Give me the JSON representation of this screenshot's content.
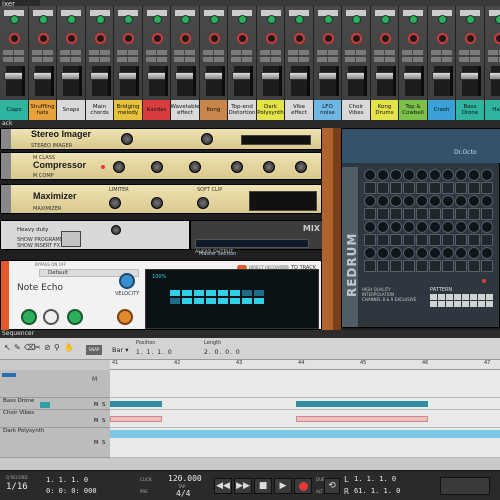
{
  "colors": {
    "accent": "#e35a2a",
    "knob_green": "#2eae5a",
    "record_red": "#d23a3a",
    "display_cyan": "#2fd0e8"
  },
  "mixer": {
    "title": "ixer",
    "channels": [
      {
        "name": "Claps",
        "color": "#2fb4a0"
      },
      {
        "name": "Shuffling hats",
        "color": "#e8a23a"
      },
      {
        "name": "Snaps",
        "color": "#d9d9d9"
      },
      {
        "name": "Main chords",
        "color": "#d9d9d9"
      },
      {
        "name": "Bridging melody",
        "color": "#e8c23a"
      },
      {
        "name": "Kasdas",
        "color": "#d83c3c"
      },
      {
        "name": "Wavetable effect",
        "color": "#d9d9d9"
      },
      {
        "name": "Kong",
        "color": "#c8864a"
      },
      {
        "name": "Top-end Distortion",
        "color": "#d9d9d9"
      },
      {
        "name": "Dark Polysynth",
        "color": "#e3e34a"
      },
      {
        "name": "Vibe effect",
        "color": "#d9d9d9"
      },
      {
        "name": "LFO noise",
        "color": "#6fb8e6"
      },
      {
        "name": "Choir Vibes",
        "color": "#d9d9d9"
      },
      {
        "name": "Kong Drums",
        "color": "#e3e34a"
      },
      {
        "name": "Top & Cowbell",
        "color": "#7cc24a"
      },
      {
        "name": "Crash",
        "color": "#3aa0d8"
      },
      {
        "name": "Bass Drone",
        "color": "#2fb4a0"
      },
      {
        "name": "Hats",
        "color": "#2fb4a0"
      }
    ]
  },
  "rack": {
    "title": "ack",
    "stereo_imager": "Stereo Imager",
    "stereo_imager_small": "STEREO IMAGER",
    "compressor": "Compressor",
    "comp_small": "M CLASS",
    "comp_sub": "M COMP",
    "maximizer": "Maximizer",
    "maxi_sub": "MAXIMIZER",
    "limiter": "LIMITER",
    "soft_clip": "SOFT CLIP",
    "mix_panel": "Heavy duty",
    "show_programmer": "SHOW PROGRAMMER",
    "show_insert_fx": "SHOW INSERT FX",
    "master_section": "Master Section",
    "audio_output": "AUDIO OUTPUT",
    "mix_badge": "MIX",
    "echo": {
      "title": "Note Echo",
      "preset": "Default",
      "bypass": "BYPASS ON OFF",
      "direct_record": "DIRECT RECORD",
      "to_track": "TO TRACK",
      "velocity": "VELOCITY",
      "percent": "100%",
      "side": "DEFAULT",
      "step_display": [
        1,
        1,
        1,
        1,
        1,
        1,
        0,
        0,
        0,
        1,
        1,
        1,
        1,
        1,
        1,
        1
      ]
    },
    "redrum": {
      "brand": "REDRUM",
      "side": "DRUM MACHINE",
      "model": "Dr.Octo",
      "high_quality": "HIGH QUALITY INTERPOLATION",
      "channel_8_9": "CHANNEL 8 & 9 EXCLUSIVE",
      "pattern": "PATTERN",
      "rnd": "ENABLE PATTERN SECTION",
      "run": "RUN"
    }
  },
  "sequencer": {
    "title": "Sequencer",
    "snap_label": "SNAP",
    "bar_value": "Bar",
    "position_label": "Position",
    "position_value": "1. 1. 1. 0",
    "length_label": "Length",
    "length_value": "2. 0. 0. 0",
    "ruler_marks": [
      "41",
      "42",
      "43",
      "44",
      "45",
      "46",
      "47"
    ],
    "tracks": [
      {
        "name": "Bass Drone"
      },
      {
        "name": "Choir Vibes"
      },
      {
        "name": "Dark Polysynth"
      }
    ],
    "transport": {
      "quantize_label": "Q RECORD",
      "quantize_value": "1/16",
      "position": "1. 1. 1. 0",
      "time": "0: 0: 0: 000",
      "tempo": "120.000",
      "tempo_label": "TAP",
      "signature": "4/4",
      "click_label": "CLICK",
      "pre_label": "PRE",
      "dub": "DUB",
      "alt": "ALT",
      "loop_l": "1. 1. 1. 0",
      "loop_r": "61. 1. 1. 0",
      "l_label": "L",
      "r_label": "R",
      "play": "▶",
      "stop": "■",
      "rewind": "◀◀",
      "forward": "▶▶",
      "back": "◀◀"
    }
  }
}
